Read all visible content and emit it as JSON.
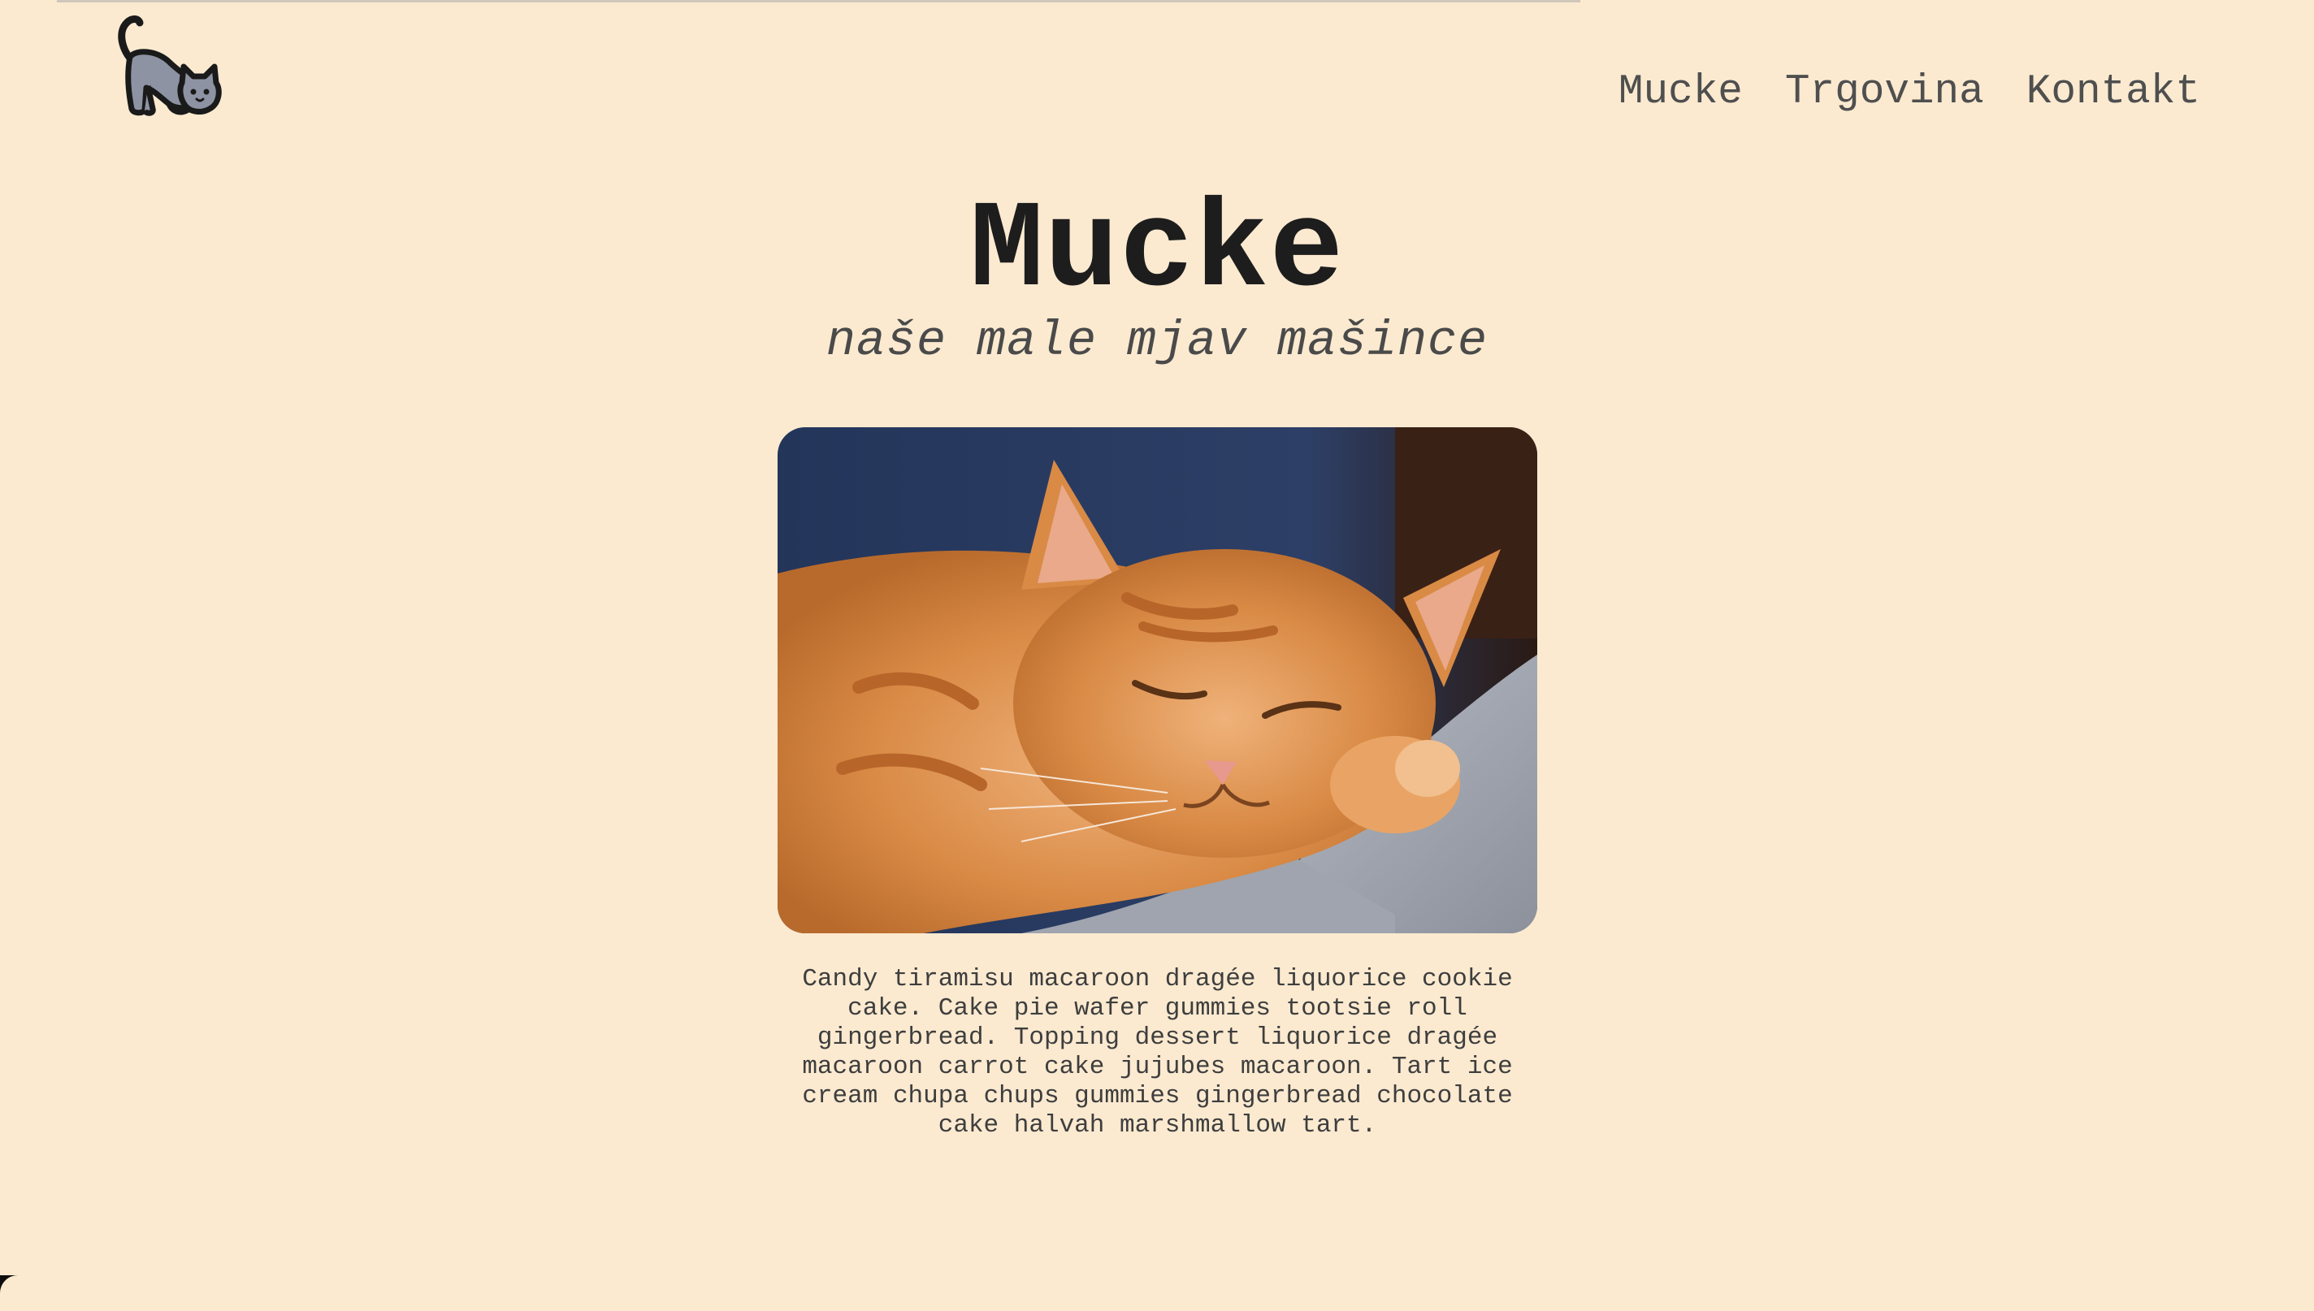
{
  "brand": {
    "logo_icon": "stretching-cat-icon"
  },
  "nav": {
    "items": [
      {
        "label": "Mucke"
      },
      {
        "label": "Trgovina"
      },
      {
        "label": "Kontakt"
      }
    ]
  },
  "hero": {
    "title": "Mucke",
    "subtitle": "naše male mjav mašince"
  },
  "photo": {
    "subject": "sleeping-ginger-cat-image"
  },
  "description": "Candy tiramisu macaroon dragée liquorice cookie cake. Cake pie wafer gummies tootsie roll gingerbread. Topping dessert liquorice dragée macaroon carrot cake jujubes macaroon. Tart ice cream chupa chups gummies gingerbread chocolate cake halvah marshmallow tart.",
  "colors": {
    "background": "#fbead0",
    "title": "#1d1d1d",
    "nav_text": "#4f4f4f",
    "body_text": "#3e3e3e"
  }
}
